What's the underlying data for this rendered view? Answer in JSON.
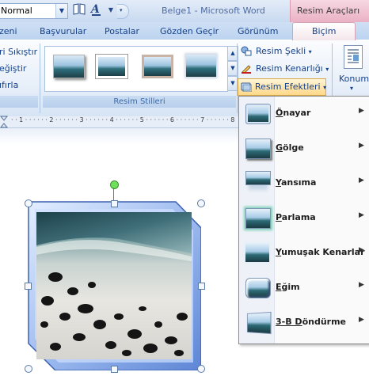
{
  "quick_access": {
    "style_combo_value": "Normal",
    "window_title": "Belge1 - Microsoft Word",
    "context_header": "Resim Araçları"
  },
  "tabs": {
    "items": [
      "zeni",
      "Başvurular",
      "Postalar",
      "Gözden Geçir",
      "Görünüm"
    ],
    "active": "Biçim"
  },
  "ribbon": {
    "adjust_items": [
      "ri Sıkıştır",
      "eğiştir",
      "ıfırla"
    ],
    "picture_styles_label": "Resim Stilleri",
    "picture_commands": [
      "Resim Şekli",
      "Resim Kenarlığı",
      "Resim Efektleri"
    ],
    "position_label": "Konum"
  },
  "ruler": {
    "text": "· · 1 · · · · · · 2 · · · · · · 3 · · · · · · 4 · · · · · · 5 · · · · · · 6 · · · · · · 7 · · · · · · 8"
  },
  "effects_menu": {
    "items": [
      {
        "label": "Önayar",
        "accel": "Ö",
        "rest": "nayar"
      },
      {
        "label": "Gölge",
        "accel": "G",
        "rest": "ölge"
      },
      {
        "label": "Yansıma",
        "accel": "Y",
        "rest": "ansıma"
      },
      {
        "label": "Parlama",
        "accel": "P",
        "rest": "arlama"
      },
      {
        "label": "Yumuşak Kenarlar",
        "accel": "Y",
        "rest": "umuşak Kenarlar"
      },
      {
        "label": "Eğim",
        "accel": "E",
        "rest": "ğim"
      },
      {
        "label": "3-B Döndürme",
        "accel": "3-B D",
        "rest": "öndürme"
      }
    ]
  },
  "colors": {
    "ribbon_blue": "#15428b",
    "context_pink": "#eab1c4",
    "highlight": "#ffd889"
  }
}
